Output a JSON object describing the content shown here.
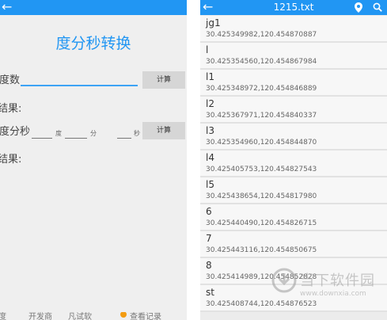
{
  "left": {
    "title": "度分秒转换",
    "deg_label": "度数",
    "deg_value": "",
    "calc1": "计算",
    "result1_label": "结果:",
    "dms_label": "度分秒",
    "deg_unit": "度",
    "min_unit": "分",
    "sec_unit": "秒",
    "calc2": "计算",
    "result2_label": "结果:",
    "bottom": [
      "度",
      "开发商",
      "凡试软",
      "查看记录"
    ]
  },
  "right": {
    "title": "1215.txt",
    "items": [
      {
        "name": "jg1",
        "coord": "30.425349982,120.454870887"
      },
      {
        "name": "l",
        "coord": "30.425354560,120.454867984"
      },
      {
        "name": "l1",
        "coord": "30.425348972,120.454846889"
      },
      {
        "name": "l2",
        "coord": "30.425367971,120.454840337"
      },
      {
        "name": "l3",
        "coord": "30.425354960,120.454844870"
      },
      {
        "name": "l4",
        "coord": "30.425405753,120.454827543"
      },
      {
        "name": "l5",
        "coord": "30.425438654,120.454817980"
      },
      {
        "name": "6",
        "coord": "30.425440490,120.454826715"
      },
      {
        "name": "7",
        "coord": "30.425443116,120.454850675"
      },
      {
        "name": "8",
        "coord": "30.425414989,120.454852828"
      },
      {
        "name": "st",
        "coord": "30.425408744,120.454876523"
      }
    ]
  },
  "watermark": {
    "text": "当下软件园",
    "url": "www.downxia.com"
  },
  "colors": {
    "accent": "#2196f3",
    "button": "#d6d6d6"
  }
}
